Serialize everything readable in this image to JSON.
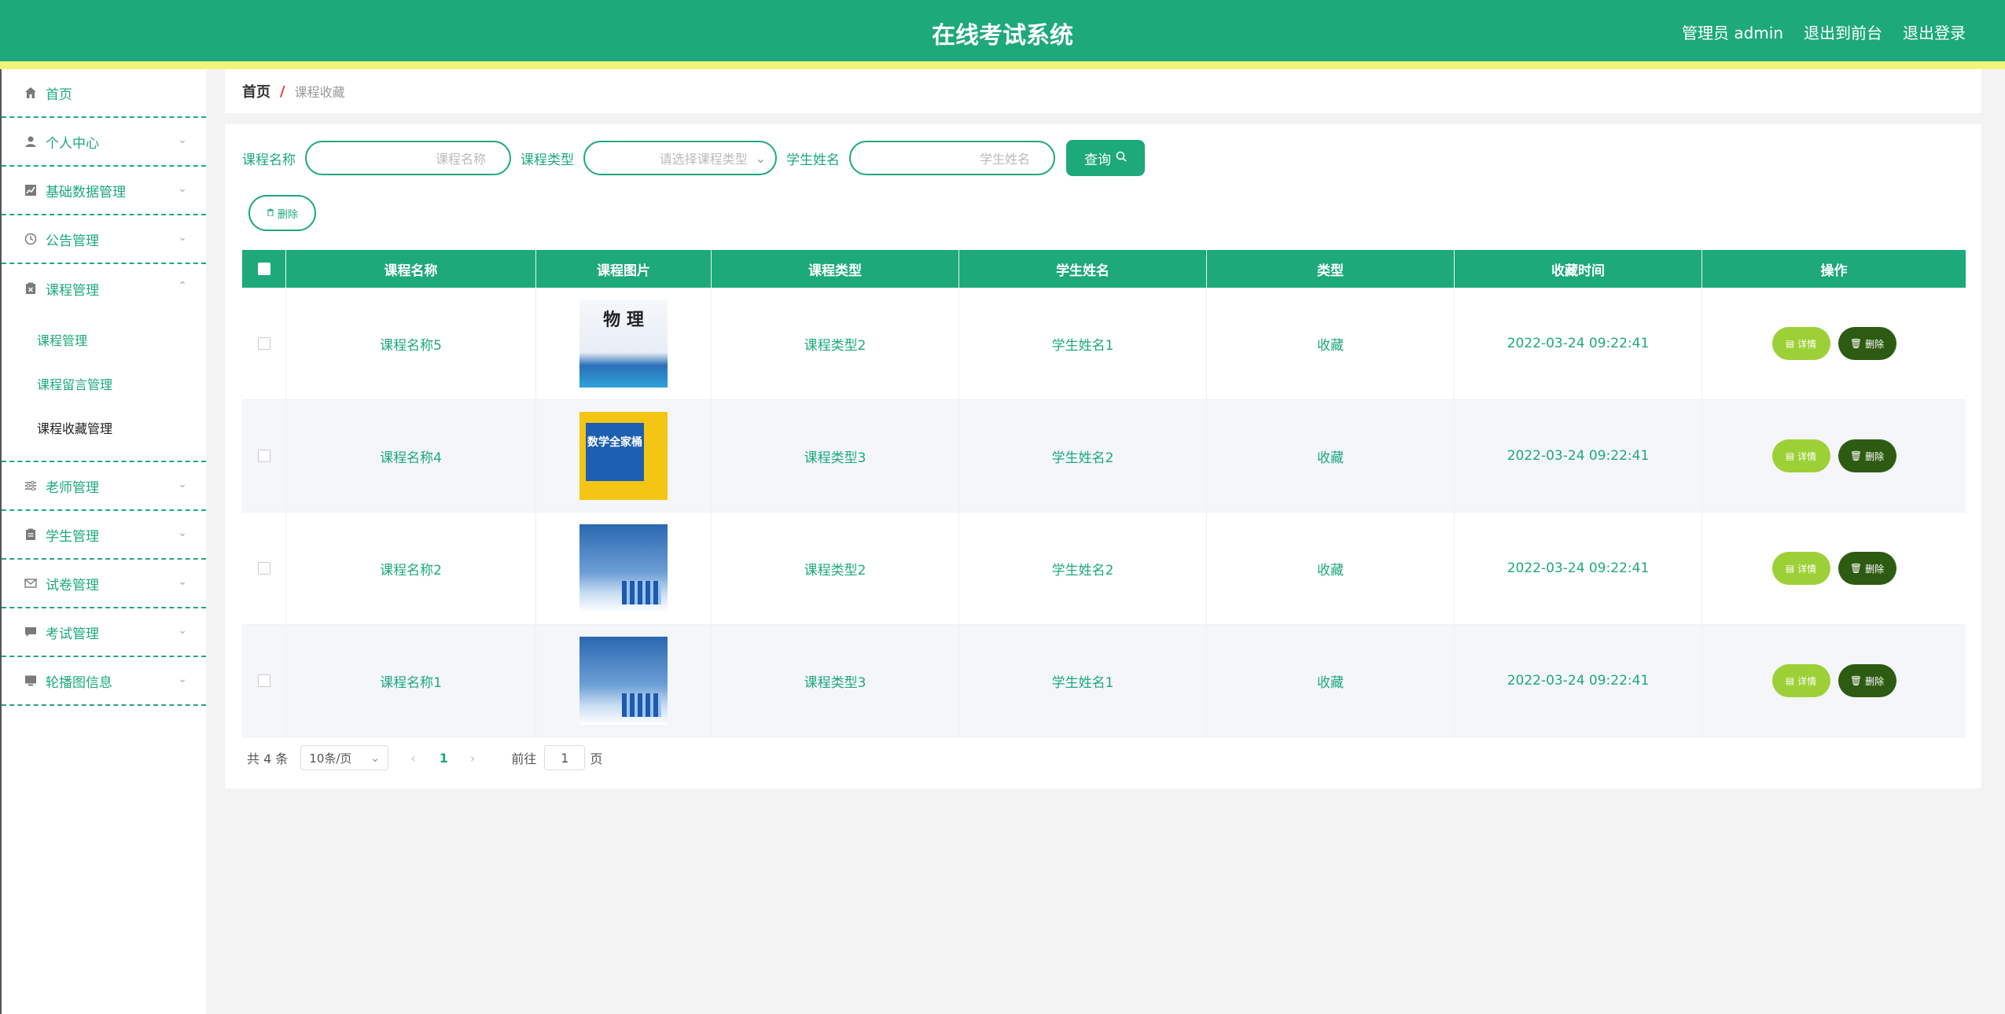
{
  "header": {
    "title": "在线考试系统",
    "links": [
      "管理员 admin",
      "退出到前台",
      "退出登录"
    ]
  },
  "sidebar": {
    "items": [
      {
        "label": "首页",
        "icon": "home-icon"
      },
      {
        "label": "个人中心",
        "icon": "user-icon"
      },
      {
        "label": "基础数据管理",
        "icon": "chart-icon"
      },
      {
        "label": "公告管理",
        "icon": "clock-icon"
      },
      {
        "label": "课程管理",
        "icon": "clipboard-x-icon"
      },
      {
        "label": "老师管理",
        "icon": "sliders-icon"
      },
      {
        "label": "学生管理",
        "icon": "clipboard-icon"
      },
      {
        "label": "试卷管理",
        "icon": "mail-icon"
      },
      {
        "label": "考试管理",
        "icon": "comment-icon"
      },
      {
        "label": "轮播图信息",
        "icon": "monitor-icon"
      }
    ],
    "course_sub": [
      "课程管理",
      "课程留言管理",
      "课程收藏管理"
    ]
  },
  "breadcrumb": {
    "home": "首页",
    "separator": "/",
    "current": "课程收藏"
  },
  "search": {
    "course_name_label": "课程名称",
    "course_name_placeholder": "课程名称",
    "course_type_label": "课程类型",
    "course_type_placeholder": "请选择课程类型",
    "student_name_label": "学生姓名",
    "student_name_placeholder": "学生姓名",
    "query_label": "查询"
  },
  "toolbar": {
    "delete_label": "删除"
  },
  "table": {
    "headers": [
      "课程名称",
      "课程图片",
      "课程类型",
      "学生姓名",
      "类型",
      "收藏时间",
      "操作"
    ],
    "rows": [
      {
        "course": "课程名称5",
        "type": "课程类型2",
        "student": "学生姓名1",
        "kind": "收藏",
        "time": "2022-03-24 09:22:41",
        "image": "物 理"
      },
      {
        "course": "课程名称4",
        "type": "课程类型3",
        "student": "学生姓名2",
        "kind": "收藏",
        "time": "2022-03-24 09:22:41",
        "image": "数学全家桶"
      },
      {
        "course": "课程名称2",
        "type": "课程类型2",
        "student": "学生姓名2",
        "kind": "收藏",
        "time": "2022-03-24 09:22:41",
        "image": ""
      },
      {
        "course": "课程名称1",
        "type": "课程类型3",
        "student": "学生姓名1",
        "kind": "收藏",
        "time": "2022-03-24 09:22:41",
        "image": ""
      }
    ],
    "detail_label": "详情",
    "delete_label": "删除"
  },
  "pagination": {
    "total": "共 4 条",
    "page_size": "10条/页",
    "current_page": "1",
    "goto_label": "前往",
    "goto_value": "1",
    "page_unit": "页"
  },
  "colors": {
    "primary": "#1da97a",
    "stripe": "#f3f37b",
    "detail": "#9dd037",
    "delete": "#2e5b12"
  }
}
